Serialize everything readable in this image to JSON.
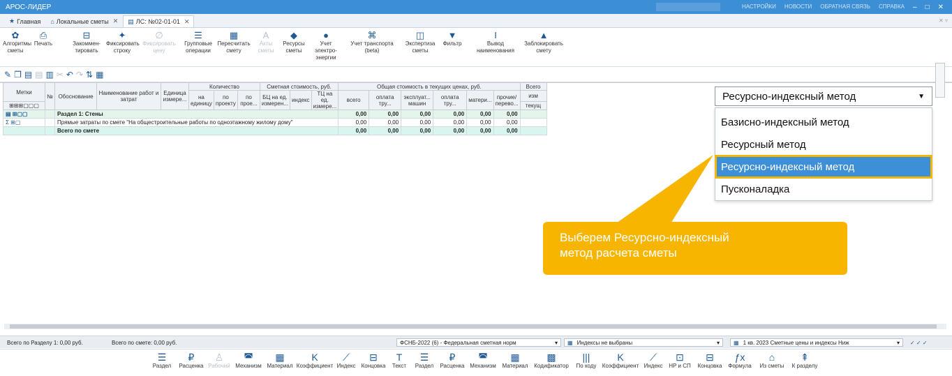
{
  "titlebar": {
    "app_name": "АРОС-ЛИДЕР",
    "menu": [
      "НАСТРОЙКИ",
      "НОВОСТИ",
      "ОБРАТНАЯ СВЯЗЬ",
      "СПРАВКА"
    ]
  },
  "tabs": [
    {
      "label": "Главная",
      "icon": "star-icon"
    },
    {
      "label": "Локальные сметы",
      "icon": "home-icon"
    },
    {
      "label": "ЛС: №02-01-01",
      "icon": "document-icon"
    }
  ],
  "ribbon": {
    "algorithms": "Алгоритмы сметы",
    "print": "Печать",
    "comment": "Закоммен-тировать",
    "fix_row": "Фиксировать строку",
    "fix_price": "Фиксировать цену",
    "group_ops": "Групповые операции",
    "recalc": "Пересчитать смету",
    "acts": "Акты сметы",
    "resources": "Ресурсы сметы",
    "electricity": "Учет электро-энергии",
    "transport": "Учет транспорта (beta)",
    "expertise": "Экспертиза сметы",
    "filter": "Фильтр",
    "naming": "Вывод наименования",
    "lock": "Заблокировать смету"
  },
  "grid": {
    "headers": {
      "marks": "Метки",
      "num": "№",
      "basis": "Обоснование",
      "name": "Наименование работ и затрат",
      "unit": "Единица измере...",
      "quantity": "Количество",
      "q_per_unit": "на единицу",
      "q_by_project": "по проекту",
      "q_by_proj2": "по прое...",
      "cost": "Сметная стоимость, руб.",
      "bc": "БЦ на ед. измерен...",
      "index": "индекс",
      "tc": "ТЦ на ед. измере...",
      "total_current": "Общая стоимость в текущих ценах, руб.",
      "all": "всего",
      "labor": "оплата тру...",
      "machines": "эксплуат... машин",
      "labor2": "оплата тру...",
      "materials": "матери...",
      "other": "прочие/ перево...",
      "all_cut": "Всего",
      "ism": "изм",
      "cur": "текущ"
    },
    "rows": [
      {
        "type": "section",
        "name": "Раздел 1: Стены",
        "values": [
          "0,00",
          "0,00",
          "0,00",
          "0,00",
          "0,00",
          "0,00"
        ]
      },
      {
        "type": "plain",
        "name": "Прямые затраты по смете \"На общестроительные работы по одноэтажному жилому дому\"",
        "values": [
          "0,00",
          "0,00",
          "0,00",
          "0,00",
          "0,00",
          "0,00"
        ]
      },
      {
        "type": "total",
        "name": "Всего по смете",
        "values": [
          "0,00",
          "0,00",
          "0,00",
          "0,00",
          "0,00",
          "0,00"
        ]
      }
    ]
  },
  "dropdown": {
    "selected": "Ресурсно-индексный метод",
    "options": [
      "Базисно-индексный метод",
      "Ресурсный метод",
      "Ресурсно-индексный метод",
      "Пусконаладка"
    ]
  },
  "callout": {
    "line1": "Выберем Ресурсно-индексный",
    "line2": "метод расчета сметы"
  },
  "status": {
    "section_total": "Всего по Разделу 1: 0,00 руб.",
    "estimate_total": "Всего по смете: 0,00 руб.",
    "norm_base": "ФСНБ-2022 (6) - Федеральная сметная норм",
    "indexes": "Индексы не выбраны",
    "prices": "1 кв. 2023 Сметные цены и индексы Ниж"
  },
  "bottom": [
    "Раздел",
    "Расценка",
    "Рабочий",
    "Механизм",
    "Материал",
    "Коэффициент",
    "Индекс",
    "Концовка",
    "Текст",
    "Раздел",
    "Расценка",
    "Механизм",
    "Материал",
    "Кодификатор",
    "По коду",
    "Коэффициент",
    "Индекс",
    "НР и СП",
    "Концовка",
    "Формула",
    "Из сметы",
    "К разделу"
  ],
  "colors": {
    "accent": "#3c8fd5",
    "callout": "#f7b500"
  }
}
